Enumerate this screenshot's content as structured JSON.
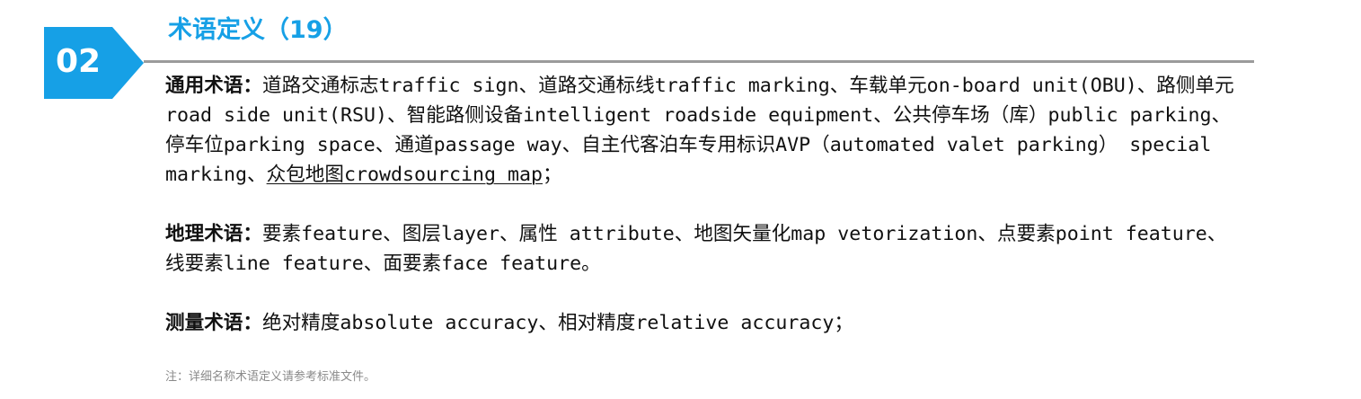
{
  "colors": {
    "accent": "#16a0e6",
    "badge": "#16a0e6",
    "divider": "#9b9b9b",
    "note": "#8a8a8a"
  },
  "section": {
    "number": "02",
    "title": "术语定义（19）"
  },
  "paragraphs": [
    {
      "label": "通用术语：",
      "before_underline": "道路交通标志traffic sign、道路交通标线traffic marking、车载单元on-board unit(OBU)、路侧单元road side unit(RSU)、智能路侧设备intelligent roadside equipment、公共停车场（库）public parking、停车位parking space、通道passage way、自主代客泊车专用标识AVP（automated valet parking） special marking、",
      "underlined": "众包地图crowdsourcing map",
      "after_underline": "；"
    },
    {
      "label": "地理术语：",
      "text": "要素feature、图层layer、属性 attribute、地图矢量化map vetorization、点要素point feature、线要素line feature、面要素face feature。"
    },
    {
      "label": "测量术语：",
      "text": "绝对精度absolute accuracy、相对精度relative accuracy；"
    }
  ],
  "note": "注：详细名称术语定义请参考标准文件。"
}
